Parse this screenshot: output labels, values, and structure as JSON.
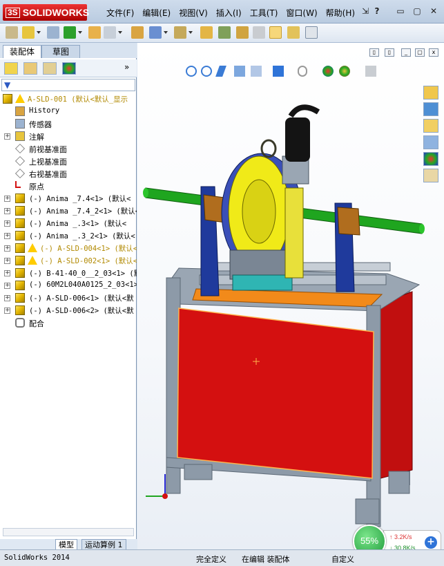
{
  "app": {
    "logo_text": "SOLIDWORKS",
    "logo_prefix": "3S"
  },
  "menu": [
    "文件(F)",
    "编辑(E)",
    "视图(V)",
    "插入(I)",
    "工具(T)",
    "窗口(W)",
    "帮助(H)"
  ],
  "window_controls": {
    "pin": "⇲",
    "help": "?",
    "minimize": "▭",
    "restore": "▢",
    "close": "✕"
  },
  "panel_tabs": {
    "assembly": "装配体",
    "sketch": "草图"
  },
  "tree": {
    "root": "A-SLD-001  (默认<默认_显示",
    "items": [
      {
        "label": "History",
        "mono": true
      },
      {
        "label": "传感器"
      },
      {
        "label": "注解"
      },
      {
        "label": "前视基准面"
      },
      {
        "label": "上视基准面"
      },
      {
        "label": "右视基准面"
      },
      {
        "label": "原点"
      },
      {
        "label": "(-) Anima _7.4<1> (默认<",
        "mono": true
      },
      {
        "label": "(-) Anima _7.4_2<1> (默认<",
        "mono": true
      },
      {
        "label": "(-) Anima _.3<1> (默认<",
        "mono": true
      },
      {
        "label": "(-) Anima _.3_2<1> (默认<",
        "mono": true
      },
      {
        "label": "(-) A-SLD-004<1> (默认<",
        "mono": true,
        "warn": true
      },
      {
        "label": "(-) A-SLD-002<1> (默认<",
        "mono": true,
        "warn": true
      },
      {
        "label": "(-) B-41-40_0__2_03<1> (默",
        "mono": true
      },
      {
        "label": "(-) 60M2L040A0125_2_03<1>",
        "mono": true
      },
      {
        "label": "(-) A-SLD-006<1> (默认<默",
        "mono": true
      },
      {
        "label": "(-) A-SLD-006<2> (默认<默",
        "mono": true
      },
      {
        "label": "配合"
      }
    ]
  },
  "bottom_tabs": {
    "model": "模型",
    "motion": "运动算例 1"
  },
  "status": {
    "app_version": "SolidWorks 2014",
    "definition": "完全定义",
    "editing": "在编辑 装配体",
    "custom": "自定义"
  },
  "network": {
    "percent": "55%",
    "up": "3.2K/s",
    "down": "30.8K/s",
    "plus": "+"
  },
  "colors": {
    "panel_red": "#d41010",
    "frame_gray": "#8d9aa8",
    "shaft_green": "#1fa51f",
    "motor_yellow": "#f0ea18",
    "clamp_blue": "#1f3a9c",
    "motor_black": "#141414"
  }
}
